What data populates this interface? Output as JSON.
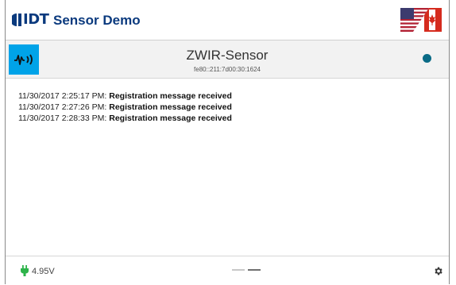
{
  "header": {
    "logo_text": "IDT",
    "title": "Sensor Demo",
    "brand_color": "#0b3a7e",
    "flag_icon": "us-canada-flag-icon"
  },
  "device": {
    "name": "ZWIR-Sensor",
    "address": "fe80::211:7d00:30:1624",
    "icon": "sensor-signal-icon",
    "status_color": "#0a6b86"
  },
  "log": [
    {
      "timestamp": "11/30/2017 2:25:17 PM:",
      "message": "Registration message received"
    },
    {
      "timestamp": "11/30/2017 2:27:26 PM:",
      "message": "Registration message received"
    },
    {
      "timestamp": "11/30/2017 2:28:33 PM:",
      "message": "Registration message received"
    }
  ],
  "footer": {
    "voltage": "4.95V",
    "power_icon": "plug-icon",
    "settings_icon": "gear-icon"
  }
}
